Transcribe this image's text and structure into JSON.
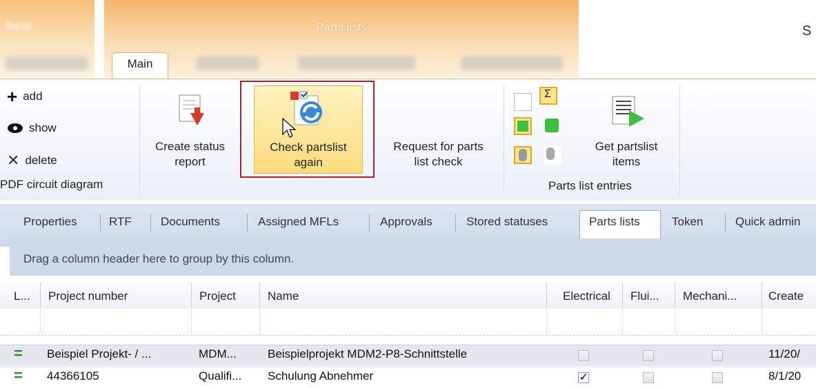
{
  "context_tabs": {
    "left_title": "Basic",
    "main_title": "Parts lists",
    "right_fragment": "S"
  },
  "ribbon_tabs": {
    "main_label": "Main"
  },
  "ribbon": {
    "small_buttons": {
      "add": "add",
      "show": "show",
      "delete": "delete",
      "pdf": "PDF circuit diagram"
    },
    "create_status": [
      "Create status",
      "report"
    ],
    "check_partslist": [
      "Check partslist",
      "again"
    ],
    "request_check": [
      "Request for parts",
      "list check"
    ],
    "get_items": [
      "Get partslist",
      "items"
    ],
    "entries_group": "Parts list entries"
  },
  "detail_tabs": [
    "Properties",
    "RTF",
    "Documents",
    "Assigned MFLs",
    "Approvals",
    "Stored statuses",
    "Parts lists",
    "Token",
    "Quick admin"
  ],
  "group_hint": "Drag a column header here to group by this column.",
  "grid": {
    "columns": [
      "L...",
      "Project number",
      "Project",
      "Name",
      "Electrical",
      "Flui...",
      "Mechani...",
      "Create"
    ],
    "rows": [
      {
        "marker": "=",
        "project_number": "Beispiel Projekt- / ...",
        "project": "MDM...",
        "name": "Beispielprojekt MDM2-P8-Schnittstelle",
        "electrical": false,
        "fluid": false,
        "mechanical": false,
        "created": "11/20/"
      },
      {
        "marker": "=",
        "project_number": "44366105",
        "project": "Qualifi...",
        "name": "Schulung Abnehmer",
        "electrical": true,
        "fluid": false,
        "mechanical": false,
        "created": "8/1/20"
      }
    ]
  },
  "colors": {
    "accent_orange": "#f6b56a",
    "highlight_red": "#a3262d",
    "selected_yellow": "#fddc7e",
    "status_green": "#2d8a2d"
  }
}
